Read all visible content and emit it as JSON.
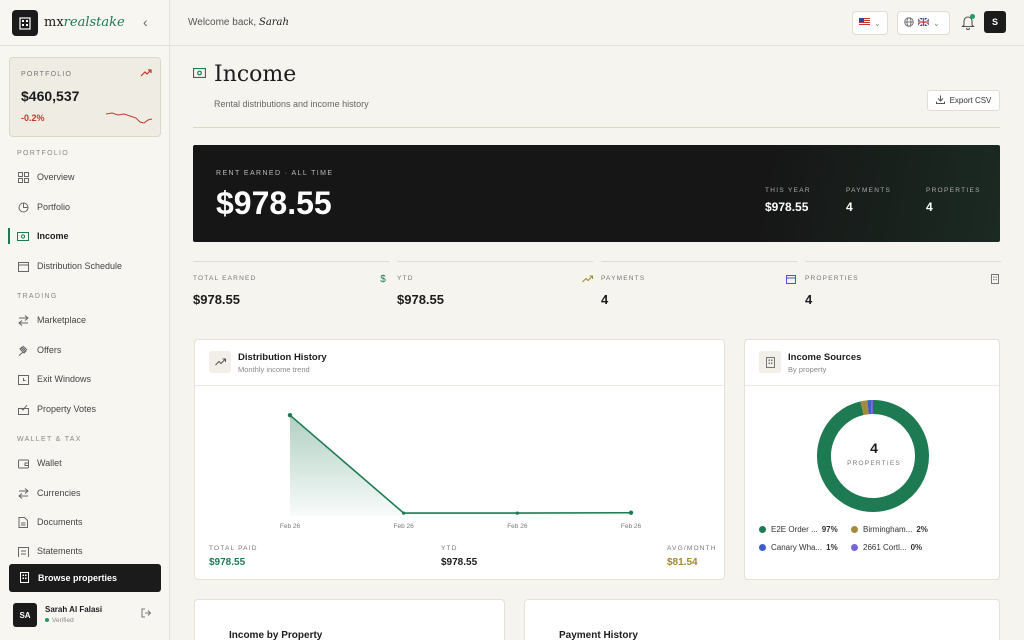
{
  "brand": {
    "prefix": "mx",
    "suffix": "realstake"
  },
  "sidebar": {
    "portfolio_card": {
      "label": "PORTFOLIO",
      "value": "$460,537",
      "change": "-0.2%"
    },
    "sections": {
      "portfolio": "PORTFOLIO",
      "trading": "TRADING",
      "wallet": "WALLET & TAX"
    },
    "items": [
      {
        "label": "Overview"
      },
      {
        "label": "Portfolio"
      },
      {
        "label": "Income"
      },
      {
        "label": "Distribution Schedule"
      },
      {
        "label": "Marketplace"
      },
      {
        "label": "Offers"
      },
      {
        "label": "Exit Windows"
      },
      {
        "label": "Property Votes"
      },
      {
        "label": "Wallet"
      },
      {
        "label": "Currencies"
      },
      {
        "label": "Documents"
      },
      {
        "label": "Statements"
      }
    ],
    "browse_label": "Browse properties",
    "user": {
      "initials": "SA",
      "name": "Sarah Al Falasi",
      "status": "Verified"
    }
  },
  "topbar": {
    "welcome": "Welcome back,",
    "name": "Sarah",
    "avatar": "S"
  },
  "header": {
    "title": "Income",
    "subtitle": "Rental distributions and income history",
    "export_label": "Export CSV"
  },
  "hero": {
    "label": "RENT EARNED · ALL TIME",
    "value": "$978.55",
    "stats": [
      {
        "label": "THIS YEAR",
        "value": "$978.55"
      },
      {
        "label": "PAYMENTS",
        "value": "4"
      },
      {
        "label": "PROPERTIES",
        "value": "4"
      }
    ]
  },
  "stats": [
    {
      "label": "TOTAL EARNED",
      "value": "$978.55",
      "icon": "$"
    },
    {
      "label": "YTD",
      "value": "$978.55"
    },
    {
      "label": "PAYMENTS",
      "value": "4"
    },
    {
      "label": "PROPERTIES",
      "value": "4"
    }
  ],
  "distribution": {
    "title": "Distribution History",
    "subtitle": "Monthly income trend",
    "footer": [
      {
        "label": "TOTAL PAID",
        "value": "$978.55",
        "color": "#1e7a52"
      },
      {
        "label": "YTD",
        "value": "$978.55",
        "color": "#1c1c1c"
      },
      {
        "label": "AVG/MONTH",
        "value": "$81.54",
        "color": "#a08a2e"
      }
    ]
  },
  "chart_data": {
    "type": "area",
    "categories": [
      "Feb 26",
      "Feb 26",
      "Feb 26",
      "Feb 26"
    ],
    "values": [
      900,
      26,
      26,
      29
    ],
    "ylim": [
      0,
      1000
    ],
    "color": "#1e7a52"
  },
  "income_sources": {
    "title": "Income Sources",
    "subtitle": "By property",
    "center_value": "4",
    "center_label": "PROPERTIES",
    "slices": [
      {
        "name": "E2E Order ...",
        "pct": "97%",
        "value": 97,
        "color": "#1e7a52"
      },
      {
        "name": "Birmingham...",
        "pct": "2%",
        "value": 2,
        "color": "#a58a3c"
      },
      {
        "name": "Canary Wha...",
        "pct": "1%",
        "value": 1,
        "color": "#3b5fc4"
      },
      {
        "name": "2661 Cortl...",
        "pct": "0%",
        "value": 0.6,
        "color": "#7a62d6"
      }
    ]
  },
  "bottom": {
    "income_by_property": "Income by Property",
    "payment_history": "Payment History"
  }
}
